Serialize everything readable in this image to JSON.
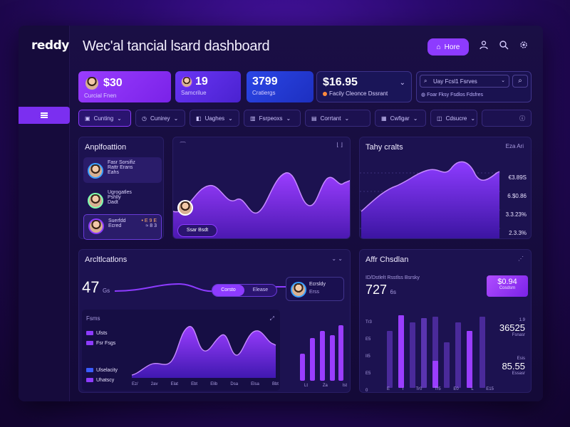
{
  "app": {
    "logo": "reddy",
    "title": "Wec'al tancial lsard dashboard",
    "top_button": "Hore"
  },
  "stats": [
    {
      "value": "$30",
      "label": "Curcial Fnen",
      "color": "#8d3bff"
    },
    {
      "value": "19",
      "label": "Samcrilue",
      "color": "#6b2cf0"
    },
    {
      "value": "3799",
      "label": "Cratiergs",
      "color": "#2a3bd8"
    },
    {
      "value": "$16.95",
      "label": "Facily Cleonce Dssrant",
      "color": "#1a1558"
    }
  ],
  "search": {
    "placeholder": "Uay Fcsl1 Fsrves",
    "sub": "Foar Fksy Fsdlos Fdsfres"
  },
  "filters": [
    "Cunting",
    "Cunirey",
    "Uaghes",
    "Fsrpeoxs",
    "Corrtant",
    "Cwfigar",
    "Cdsucre"
  ],
  "applications": {
    "title": "Anplfoattion",
    "items": [
      {
        "line1": "Fasr Sorsifiz",
        "line2": "Rattr Erans",
        "line3": "Eahs"
      },
      {
        "line1": "Ugrogatles",
        "line2": "Pshlly",
        "line3": "Dadt"
      },
      {
        "line1": "Suerfdd",
        "line2": "Ecred",
        "value": "• E 9 E",
        "value2": "≈ 8 3"
      }
    ]
  },
  "trend_card": {
    "button": "Ssar Bsdt",
    "menu_left": "⁀",
    "menu_right": "⌊ ⌋"
  },
  "tally": {
    "title": "Tahy cralts",
    "corner": "Eza Ari",
    "labels": [
      "€3.89S",
      "6.$0.86",
      "3.3.23%",
      "2.3.3%"
    ]
  },
  "applications2": {
    "title": "Arcltlcatlons",
    "big_value": "47",
    "big_unit": "Gs",
    "toggle_a": "Corsto",
    "toggle_b": "Elease",
    "person_name": "Ecrsldy",
    "person_sub": "Erss",
    "legend_title": "Fsms",
    "legend": [
      {
        "label": "Ulsts",
        "color": "#8d3bff"
      },
      {
        "label": "Fsr Fsgs",
        "color": "#8d3bff"
      },
      {
        "label": "Ulselacity",
        "color": "#3a5bff"
      },
      {
        "label": "Uhatscy",
        "color": "#8d3bff"
      }
    ],
    "x_ticks": [
      "Ez/",
      "2av",
      "Elat",
      "Ebt",
      "Elib",
      "Dsa",
      "Elsa",
      "Bbt"
    ],
    "bar_ticks": [
      "Lt",
      "Za",
      "Ist"
    ]
  },
  "chart_side": {
    "title": "Affr Chsdlan",
    "sub": "ID/Dstlelt Rsstlss Bsrsky",
    "big_value": "727",
    "big_unit": "6s",
    "badge_value": "$0.94",
    "badge_sub": "Cosdsrn",
    "val1": "36525",
    "val1_top": "1.9",
    "val1_sub": "Fsnasr",
    "val2": "85.55",
    "val2_top": "Esis",
    "val2_sub": "Essasr",
    "y_ticks": [
      "Tr3",
      "E5",
      "II5",
      "E5",
      "0"
    ],
    "x_ticks": [
      "E",
      "i",
      "Tr0",
      "Tr5",
      "E0",
      "L",
      "E15"
    ]
  },
  "colors": {
    "accent": "#8d3bff",
    "accent_bright": "#b06bff",
    "panel": "#1c1250",
    "bg": "#140a38"
  }
}
